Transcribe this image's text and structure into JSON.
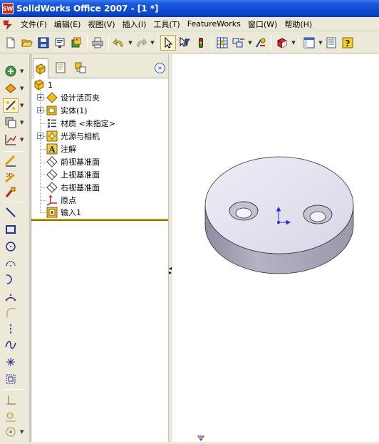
{
  "window": {
    "title": "SolidWorks Office 2007 - [1 *]",
    "logo_text": "SW"
  },
  "menu": [
    {
      "label": "文件(F)"
    },
    {
      "label": "编辑(E)"
    },
    {
      "label": "视图(V)"
    },
    {
      "label": "插入(I)"
    },
    {
      "label": "工具(T)"
    },
    {
      "label": "FeatureWorks"
    },
    {
      "label": "窗口(W)"
    },
    {
      "label": "帮助(H)"
    }
  ],
  "toolbar": {
    "icons": [
      "new-icon",
      "open-icon",
      "save-icon",
      "print-preview-icon",
      "options-icon",
      "print-icon",
      "undo-icon",
      "redo-icon",
      "select-icon",
      "select-filter-icon",
      "rebuild-icon",
      "grid-icon",
      "sketch-relations-icon",
      "smart-dimension-icon",
      "view-orientation-icon",
      "display-style-icon",
      "properties-icon",
      "help-icon"
    ]
  },
  "feature_manager": {
    "tabs": [
      "featuremanager-tab",
      "propertymanager-tab",
      "configurationmanager-tab"
    ],
    "collapse_symbol": "»",
    "root": {
      "label": "1"
    },
    "items": [
      {
        "label": "设计活页夹",
        "expandable": true,
        "icon": "design-binder-icon"
      },
      {
        "label": "实体(1)",
        "expandable": true,
        "icon": "solid-bodies-icon"
      },
      {
        "label": "材质 <未指定>",
        "expandable": false,
        "icon": "material-icon"
      },
      {
        "label": "光源与相机",
        "expandable": true,
        "icon": "lights-cameras-icon"
      },
      {
        "label": "注解",
        "expandable": false,
        "icon": "annotations-icon"
      },
      {
        "label": "前视基准面",
        "expandable": false,
        "icon": "plane-icon"
      },
      {
        "label": "上视基准面",
        "expandable": false,
        "icon": "plane-icon"
      },
      {
        "label": "右视基准面",
        "expandable": false,
        "icon": "plane-icon"
      },
      {
        "label": "原点",
        "expandable": false,
        "icon": "origin-icon"
      },
      {
        "label": "输入1",
        "expandable": false,
        "icon": "imported-feature-icon"
      }
    ]
  },
  "colors": {
    "titlebar": "#0a44c8",
    "part_face": "#e6e4f2",
    "part_side": "#a8a6b8",
    "rollback_bar": "#f0c800",
    "origin": "#1f33c8"
  }
}
